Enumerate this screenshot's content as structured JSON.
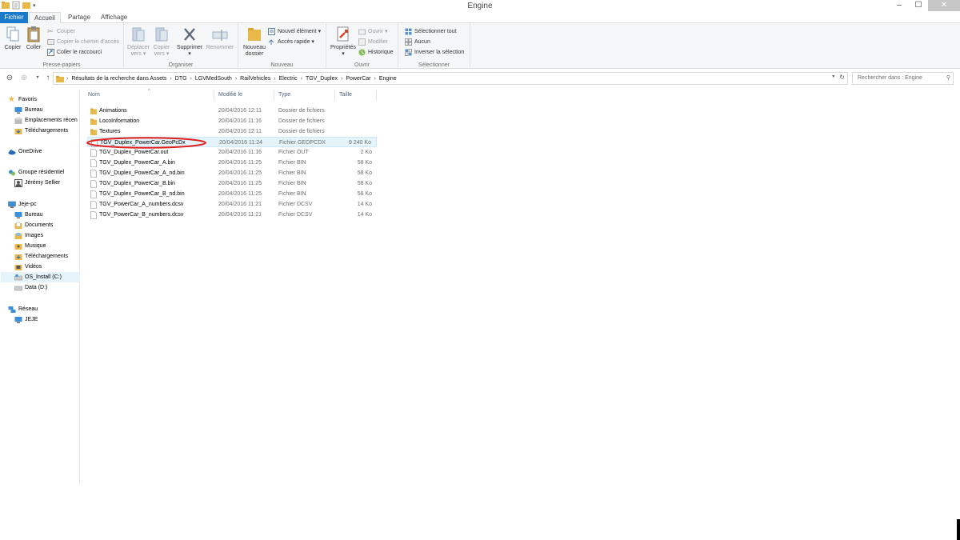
{
  "window": {
    "title": "Engine"
  },
  "tabs": {
    "fichier": "Fichier",
    "accueil": "Accueil",
    "partage": "Partage",
    "affichage": "Affichage"
  },
  "ribbon": {
    "presse_papiers": {
      "label": "Presse-papiers",
      "copier": "Copier",
      "coller": "Coller",
      "couper": "Couper",
      "copier_chemin": "Copier le chemin d'accès",
      "coller_raccourci": "Coller le raccourci"
    },
    "organiser": {
      "label": "Organiser",
      "deplacer_1": "Déplacer",
      "deplacer_2": "vers ▾",
      "copier_1": "Copier",
      "copier_2": "vers ▾",
      "supprimer": "Supprimer",
      "supprimer_arrow": "▾",
      "renommer": "Renommer"
    },
    "nouveau": {
      "label": "Nouveau",
      "nouveau_dossier_1": "Nouveau",
      "nouveau_dossier_2": "dossier",
      "nouvel_element": "Nouvel élément ▾",
      "acces_rapide": "Accès rapide ▾"
    },
    "ouvrir": {
      "label": "Ouvrir",
      "proprietes": "Propriétés",
      "proprietes_arrow": "▾",
      "ouvrir": "Ouvrir ▾",
      "modifier": "Modifier",
      "historique": "Historique"
    },
    "selectionner": {
      "label": "Sélectionner",
      "tout": "Sélectionner tout",
      "aucun": "Aucun",
      "inverser": "Inverser la sélection"
    }
  },
  "address": {
    "crumbs": [
      "Résultats de la recherche dans Assets",
      "DTG",
      "LGVMedSouth",
      "RailVehicles",
      "Electric",
      "TGV_Duplex",
      "PowerCar",
      "Engine"
    ],
    "search_placeholder": "Rechercher dans : Engine"
  },
  "nav": {
    "favoris": "Favoris",
    "bureau": "Bureau",
    "emplacements": "Emplacements récen",
    "telechargements": "Téléchargements",
    "onedrive": "OneDrive",
    "groupe": "Groupe résidentiel",
    "jeremy": "Jérémy Sellier",
    "pc": "Jeje-pc",
    "pc_bureau": "Bureau",
    "documents": "Documents",
    "images": "Images",
    "musique": "Musique",
    "pc_telechargements": "Téléchargements",
    "videos": "Vidéos",
    "os_install": "OS_Install (C:)",
    "data": "Data (D:)",
    "reseau": "Réseau",
    "jeje": "JEJE"
  },
  "columns": {
    "nom": "Nom",
    "modifie": "Modifié le",
    "type": "Type",
    "taille": "Taille"
  },
  "files": [
    {
      "name": "Animations",
      "date": "20/04/2016 12:11",
      "type": "Dossier de fichiers",
      "size": "",
      "icon": "folder-icon"
    },
    {
      "name": "LocoInformation",
      "date": "20/04/2016 11:16",
      "type": "Dossier de fichiers",
      "size": "",
      "icon": "folder-icon"
    },
    {
      "name": "Textures",
      "date": "20/04/2016 12:11",
      "type": "Dossier de fichiers",
      "size": "",
      "icon": "folder-icon"
    },
    {
      "name": "TGV_Duplex_PowerCar.GeoPcDx",
      "date": "20/04/2016 11:24",
      "type": "Fichier GEOPCDX",
      "size": "9 240 Ko",
      "icon": "file-icon"
    },
    {
      "name": "TGV_Duplex_PowerCar.out",
      "date": "20/04/2016 11:16",
      "type": "Fichier OUT",
      "size": "2 Ko",
      "icon": "file-icon"
    },
    {
      "name": "TGV_Duplex_PowerCar_A.bin",
      "date": "20/04/2016 11:25",
      "type": "Fichier BIN",
      "size": "58 Ko",
      "icon": "file-icon"
    },
    {
      "name": "TGV_Duplex_PowerCar_A_nd.bin",
      "date": "20/04/2016 11:25",
      "type": "Fichier BIN",
      "size": "58 Ko",
      "icon": "file-icon"
    },
    {
      "name": "TGV_Duplex_PowerCar_B.bin",
      "date": "20/04/2016 11:25",
      "type": "Fichier BIN",
      "size": "58 Ko",
      "icon": "file-icon"
    },
    {
      "name": "TGV_Duplex_PowerCar_B_nd.bin",
      "date": "20/04/2016 11:25",
      "type": "Fichier BIN",
      "size": "58 Ko",
      "icon": "file-icon"
    },
    {
      "name": "TGV_PowerCar_A_numbers.dcsv",
      "date": "20/04/2016 11:21",
      "type": "Fichier DCSV",
      "size": "14 Ko",
      "icon": "file-icon"
    },
    {
      "name": "TGV_PowerCar_B_numbers.dcsv",
      "date": "20/04/2016 11:21",
      "type": "Fichier DCSV",
      "size": "14 Ko",
      "icon": "file-icon"
    }
  ],
  "selected_file_index": 3,
  "colors": {
    "accent": "#1979ca",
    "selection": "#e5f3fb",
    "annotation": "#e0201f",
    "folder": "#e8b94a"
  }
}
